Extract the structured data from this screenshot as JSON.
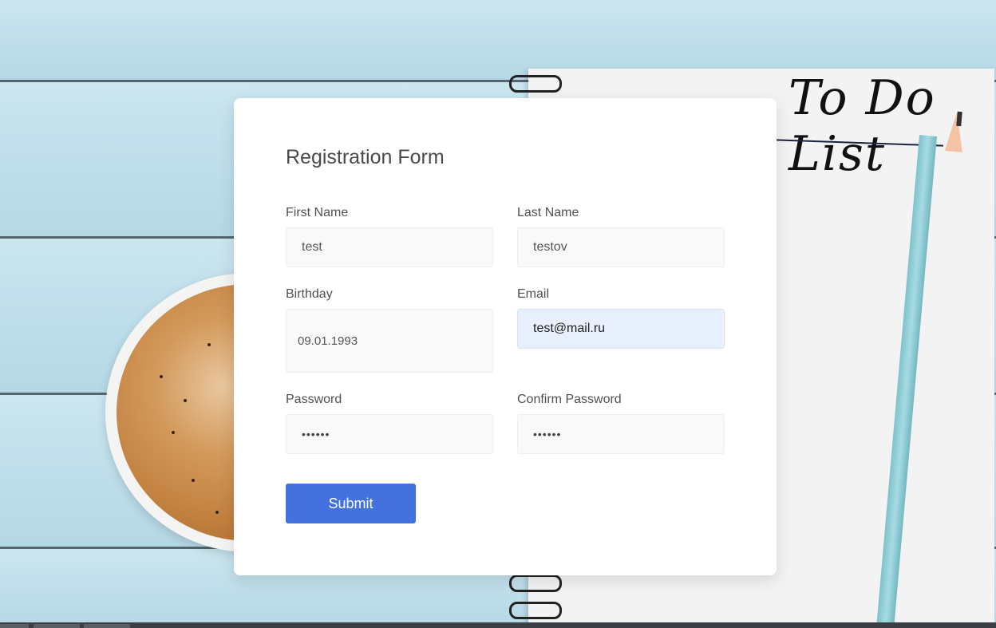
{
  "background": {
    "notebook_title": "To Do List"
  },
  "form": {
    "title": "Registration Form",
    "fields": {
      "first_name": {
        "label": "First Name",
        "value": "test"
      },
      "last_name": {
        "label": "Last Name",
        "value": "testov"
      },
      "birthday": {
        "label": "Birthday",
        "value": "09.01.1993"
      },
      "email": {
        "label": "Email",
        "value": "test@mail.ru"
      },
      "password": {
        "label": "Password",
        "value": "••••••"
      },
      "confirm_password": {
        "label": "Confirm Password",
        "value": "••••••"
      }
    },
    "submit_label": "Submit"
  },
  "colors": {
    "accent": "#4371dd",
    "autofill_bg": "#e8f0fe",
    "card_bg": "#ffffff"
  }
}
